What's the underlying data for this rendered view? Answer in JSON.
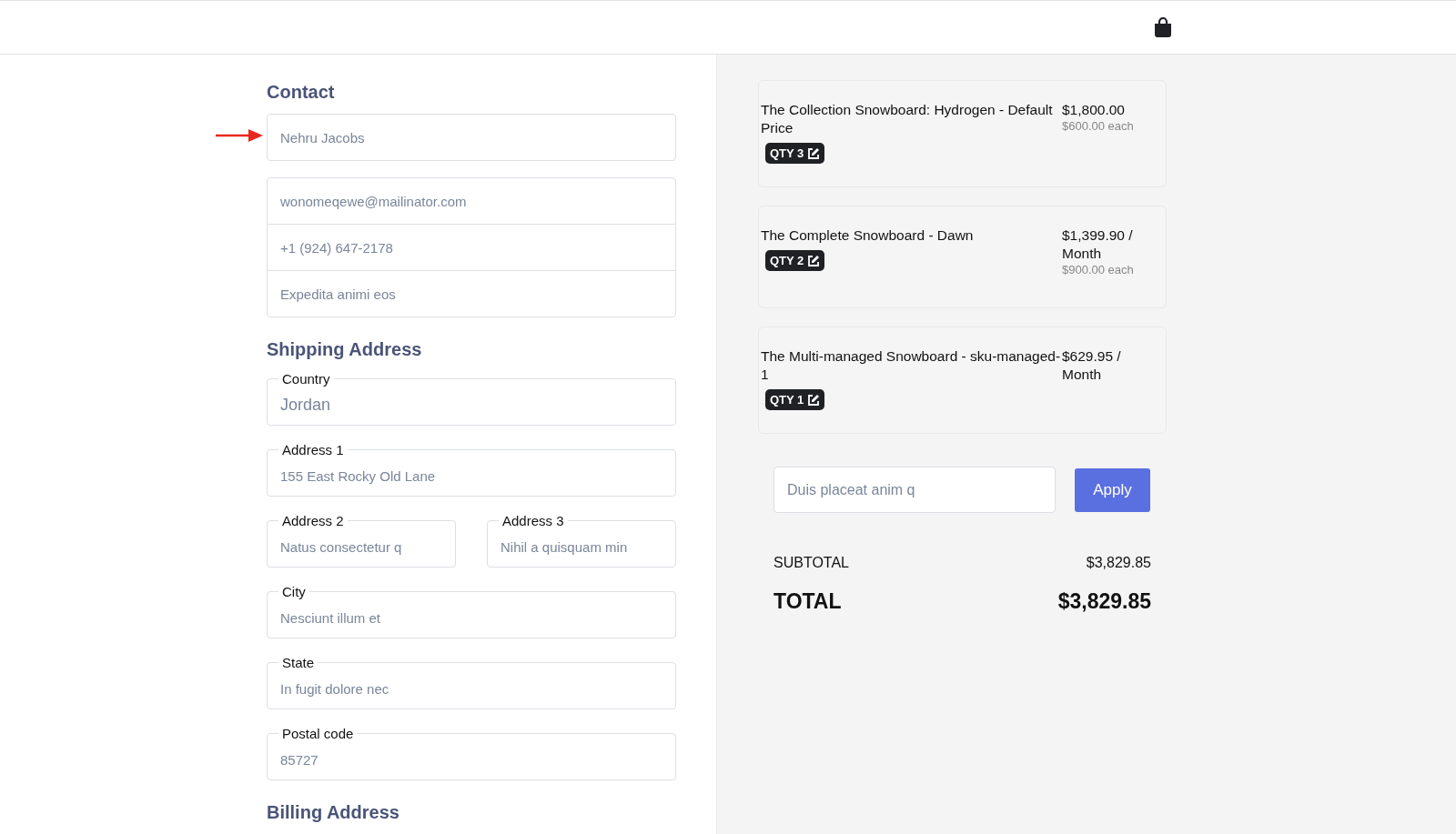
{
  "contact": {
    "heading": "Contact",
    "name": {
      "value": "Nehru Jacobs"
    },
    "fields": [
      {
        "value": "wonomeqewe@mailinator.com"
      },
      {
        "value": "+1 (924) 647-2178"
      },
      {
        "value": "Expedita animi eos"
      }
    ]
  },
  "shipping": {
    "heading": "Shipping Address",
    "rows": [
      [
        {
          "kind": "select",
          "label": "Country",
          "value": "Jordan"
        }
      ],
      [
        {
          "kind": "text",
          "label": "Address 1",
          "value": "155 East Rocky Old Lane"
        }
      ],
      [
        {
          "kind": "text",
          "label": "Address 2",
          "value": "Natus consectetur q"
        },
        {
          "kind": "text",
          "label": "Address 3",
          "value": "Nihil a quisquam min"
        }
      ],
      [
        {
          "kind": "text",
          "label": "City",
          "value": "Nesciunt illum et"
        }
      ],
      [
        {
          "kind": "text",
          "label": "State",
          "value": "In fugit dolore nec"
        }
      ],
      [
        {
          "kind": "text",
          "label": "Postal code",
          "value": "85727"
        }
      ]
    ]
  },
  "billing": {
    "heading": "Billing Address"
  },
  "cart": {
    "items": [
      {
        "title": "The Collection Snowboard: Hydrogen - Default Price",
        "price": "$1,800.00",
        "each": "$600.00 each",
        "qty": "QTY 3"
      },
      {
        "title": "The Complete Snowboard - Dawn",
        "price": "$1,399.90 / Month",
        "each": "$900.00 each",
        "qty": "QTY 2"
      },
      {
        "title": "The Multi-managed Snowboard - sku-managed-1",
        "price": "$629.95 / Month",
        "qty": "QTY 1"
      }
    ],
    "coupon": {
      "value": "Duis placeat anim q"
    },
    "apply": "Apply",
    "subtotal": {
      "label": "SUBTOTAL",
      "value": "$3,829.85"
    },
    "total": {
      "label": "TOTAL",
      "value": "$3,829.85"
    }
  }
}
